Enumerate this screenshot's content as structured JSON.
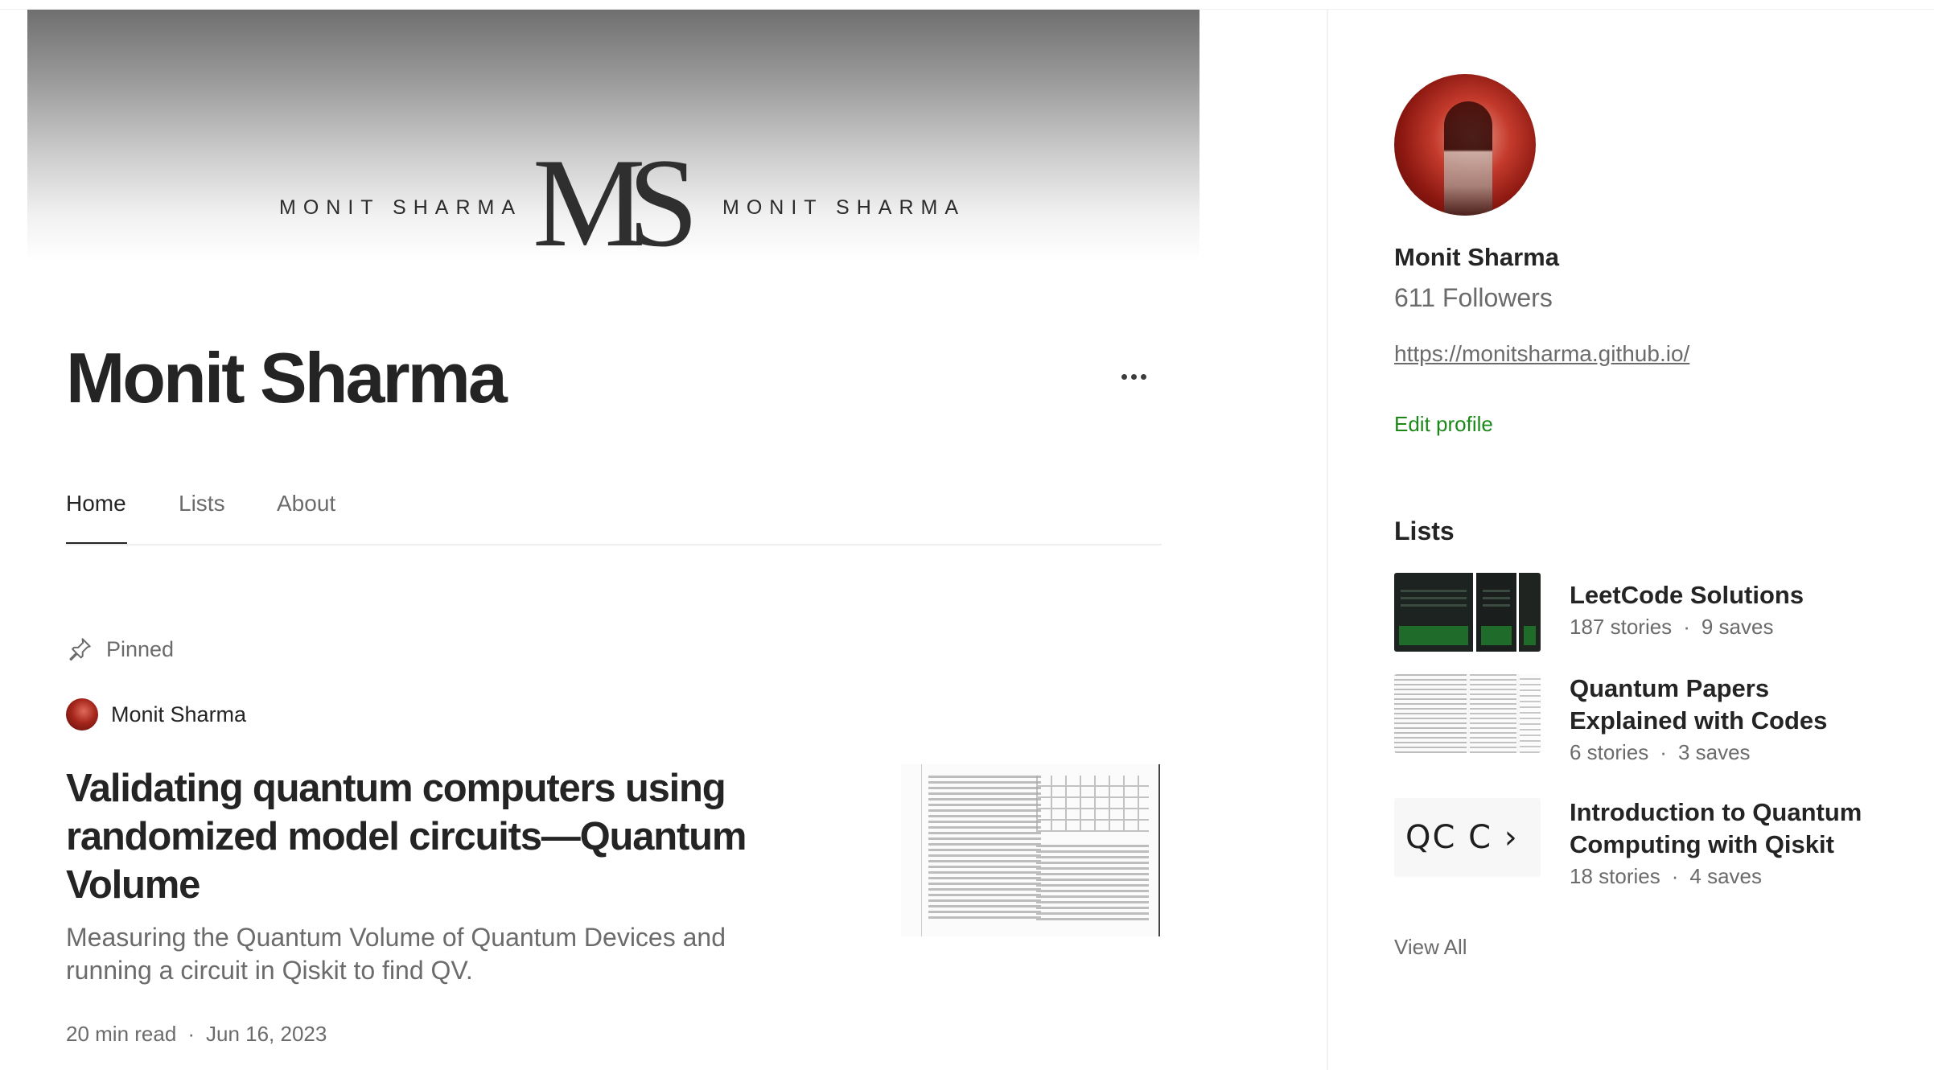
{
  "banner": {
    "logo": "MS",
    "text_left": "MONIT SHARMA",
    "text_right": "MONIT SHARMA"
  },
  "profile": {
    "name": "Monit Sharma"
  },
  "tabs": [
    {
      "label": "Home",
      "active": true
    },
    {
      "label": "Lists",
      "active": false
    },
    {
      "label": "About",
      "active": false
    }
  ],
  "pinned": {
    "label": "Pinned",
    "author": "Monit Sharma",
    "title": "Validating quantum computers using randomized model circuits—Quantum Volume",
    "subtitle": "Measuring the Quantum Volume of Quantum Devices and running a circuit in Qiskit to find QV.",
    "read_time": "20 min read",
    "separator": "·",
    "date": "Jun 16, 2023"
  },
  "sidebar": {
    "name": "Monit Sharma",
    "followers": "611 Followers",
    "link": "https://monitsharma.github.io/",
    "edit_profile": "Edit profile",
    "lists_heading": "Lists",
    "lists": [
      {
        "title": "LeetCode Solutions",
        "stories": "187 stories",
        "saves": "9 saves"
      },
      {
        "title": "Quantum Papers Explained with Codes",
        "stories": "6 stories",
        "saves": "3 saves"
      },
      {
        "title": "Introduction to Quantum Computing with Qiskit",
        "stories": "18 stories",
        "saves": "4 saves"
      }
    ],
    "view_all": "View All"
  },
  "colors": {
    "text_primary": "#242424",
    "text_secondary": "#6b6b6b",
    "accent_green": "#1a8917"
  },
  "icons": {
    "more": "ellipsis-icon",
    "pin": "pin-icon"
  }
}
